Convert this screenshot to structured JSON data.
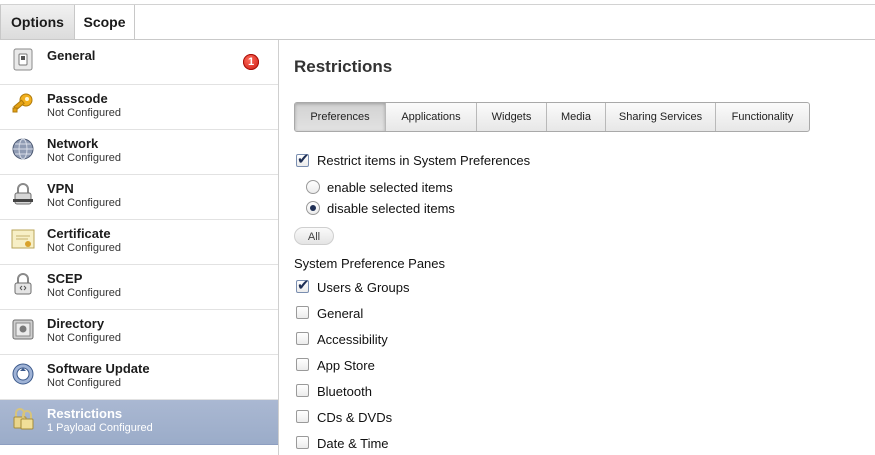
{
  "top_tabs": {
    "options": "Options",
    "scope": "Scope"
  },
  "sidebar": {
    "items": [
      {
        "title": "General",
        "subtitle": "",
        "icon": "general-switch-icon",
        "badge": "1"
      },
      {
        "title": "Passcode",
        "subtitle": "Not Configured",
        "icon": "key-icon"
      },
      {
        "title": "Network",
        "subtitle": "Not Configured",
        "icon": "globe-icon"
      },
      {
        "title": "VPN",
        "subtitle": "Not Configured",
        "icon": "vpn-lock-icon"
      },
      {
        "title": "Certificate",
        "subtitle": "Not Configured",
        "icon": "certificate-icon"
      },
      {
        "title": "SCEP",
        "subtitle": "Not Configured",
        "icon": "scep-lock-icon"
      },
      {
        "title": "Directory",
        "subtitle": "Not Configured",
        "icon": "directory-icon"
      },
      {
        "title": "Software Update",
        "subtitle": "Not Configured",
        "icon": "software-update-icon"
      },
      {
        "title": "Restrictions",
        "subtitle": "1 Payload Configured",
        "icon": "restrictions-lock-icon",
        "selected": true
      }
    ]
  },
  "main": {
    "title": "Restrictions",
    "tabs": [
      "Preferences",
      "Applications",
      "Widgets",
      "Media",
      "Sharing Services",
      "Functionality"
    ],
    "active_tab": "Preferences",
    "restrict_checkbox": {
      "label": "Restrict items in System Preferences",
      "checked": true
    },
    "radio_options": [
      {
        "label": "enable selected items",
        "selected": false
      },
      {
        "label": "disable selected items",
        "selected": true
      }
    ],
    "all_button": "All",
    "panes_heading": "System Preference Panes",
    "panes": [
      {
        "label": "Users & Groups",
        "checked": true
      },
      {
        "label": "General",
        "checked": false
      },
      {
        "label": "Accessibility",
        "checked": false
      },
      {
        "label": "App Store",
        "checked": false
      },
      {
        "label": "Bluetooth",
        "checked": false
      },
      {
        "label": "CDs & DVDs",
        "checked": false
      },
      {
        "label": "Date & Time",
        "checked": false
      }
    ]
  },
  "colors": {
    "selected_row": "#9bacc9",
    "badge": "#d3180f",
    "check_mark": "#1f2f55"
  }
}
